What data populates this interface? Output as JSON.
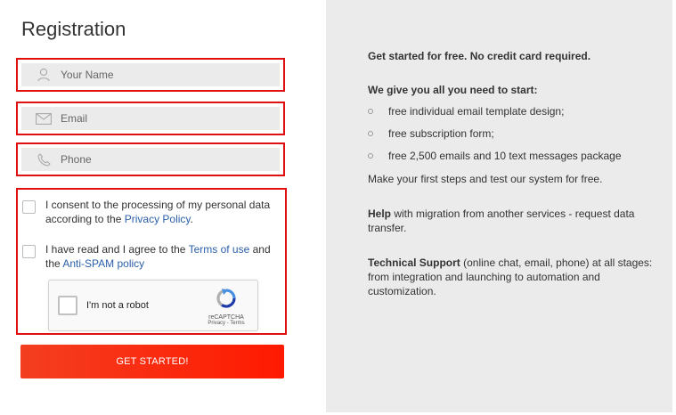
{
  "form": {
    "title": "Registration",
    "name_placeholder": "Your Name",
    "email_placeholder": "Email",
    "phone_placeholder": "Phone",
    "consent1_text": "I consent to the processing of my personal data according to the",
    "consent1_link": "Privacy Policy",
    "consent1_suffix": ".",
    "consent2_text": "I have read and I agree to the",
    "consent2_link1": "Terms of use",
    "consent2_mid": "and the",
    "consent2_link2": "Anti-SPAM policy",
    "recaptcha_label": "I'm not a robot",
    "recaptcha_brand": "reCAPTCHA",
    "recaptcha_privacy": "Privacy",
    "recaptcha_sep": " - ",
    "recaptcha_terms": "Terms",
    "submit_label": "GET STARTED!"
  },
  "info": {
    "headline": "Get started for free. No credit card required.",
    "give_heading": "We give you all you need to start:",
    "bullets": [
      "free individual email template design;",
      "free subscription form;",
      "free 2,500 emails and 10 text messages package"
    ],
    "first_steps": "Make your first steps and test our system for free.",
    "help_bold": "Help",
    "help_text": " with migration from another services - request data transfer.",
    "support_bold": "Technical Support",
    "support_text": " (online chat, email, phone) at all stages: from integration and launching to automation and customization."
  },
  "colors": {
    "highlight_border": "#e01010",
    "submit_bg": "#ff2a12",
    "link": "#2b5fa8",
    "panel_bg": "#ebebeb"
  },
  "icons": {
    "name": "user-icon",
    "email": "envelope-icon",
    "phone": "phone-icon",
    "recaptcha": "recaptcha-logo-icon"
  }
}
